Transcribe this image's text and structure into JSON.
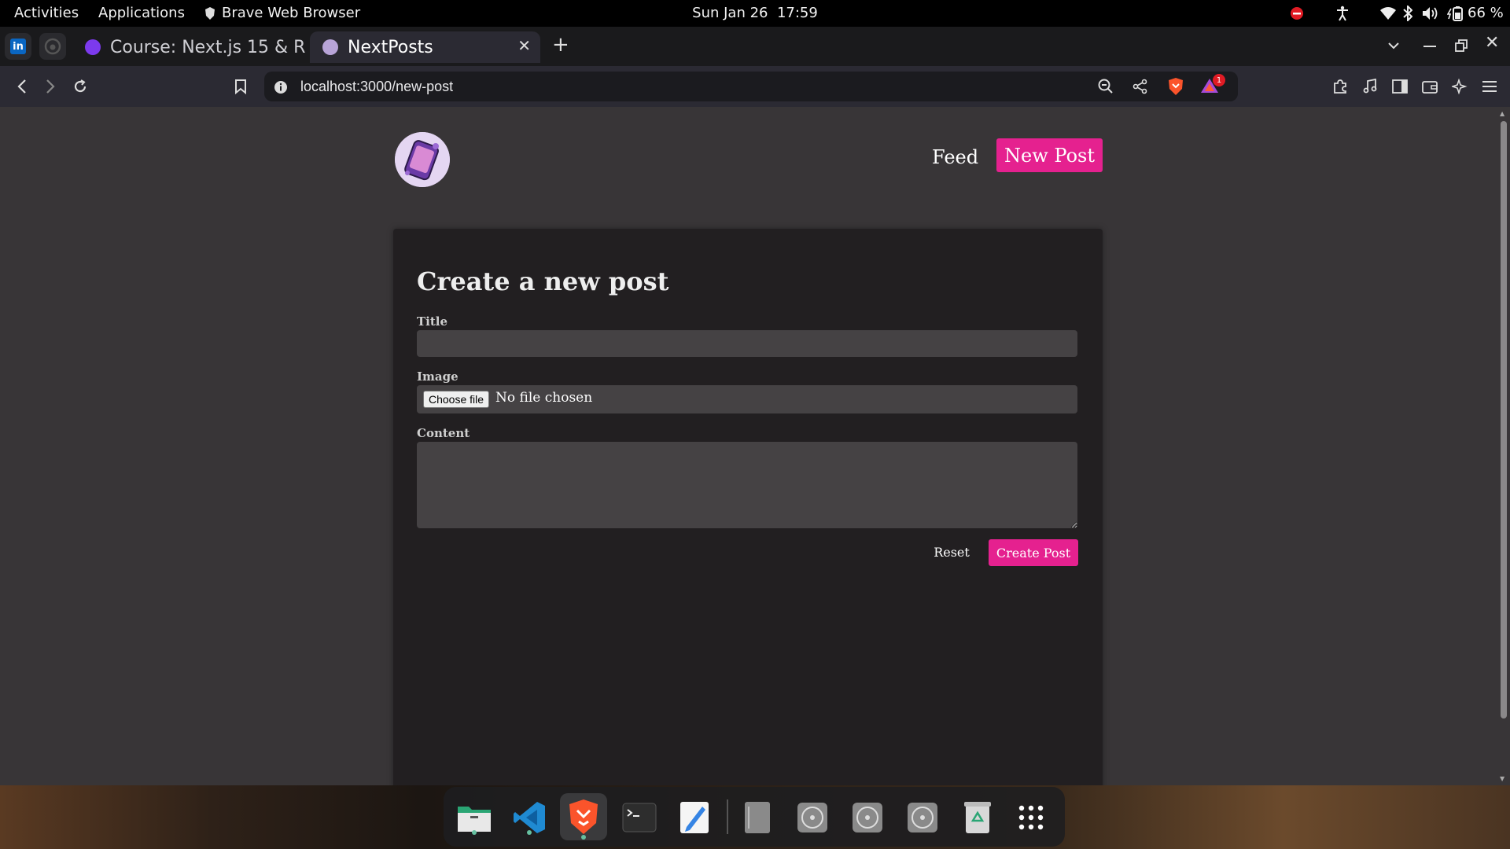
{
  "system_bar": {
    "activities": "Activities",
    "applications": "Applications",
    "active_app": "Brave Web Browser",
    "date": "Sun Jan 26",
    "time": "17:59",
    "battery": "66 %"
  },
  "browser": {
    "tabs": [
      {
        "label": "Course: Next.js 15 & R",
        "active": false
      },
      {
        "label": "NextPosts",
        "active": true
      }
    ],
    "url": "localhost:3000/new-post",
    "notification_count": "1"
  },
  "page": {
    "nav": {
      "feed": "Feed",
      "new_post": "New Post"
    },
    "form": {
      "heading": "Create a new post",
      "title_label": "Title",
      "title_value": "",
      "image_label": "Image",
      "choose_file": "Choose file",
      "no_file": "No file chosen",
      "content_label": "Content",
      "content_value": "",
      "reset": "Reset",
      "submit": "Create Post"
    }
  },
  "colors": {
    "accent": "#e5218f",
    "page_bg": "#383537",
    "card_bg": "#221f21",
    "input_bg": "#454244"
  }
}
